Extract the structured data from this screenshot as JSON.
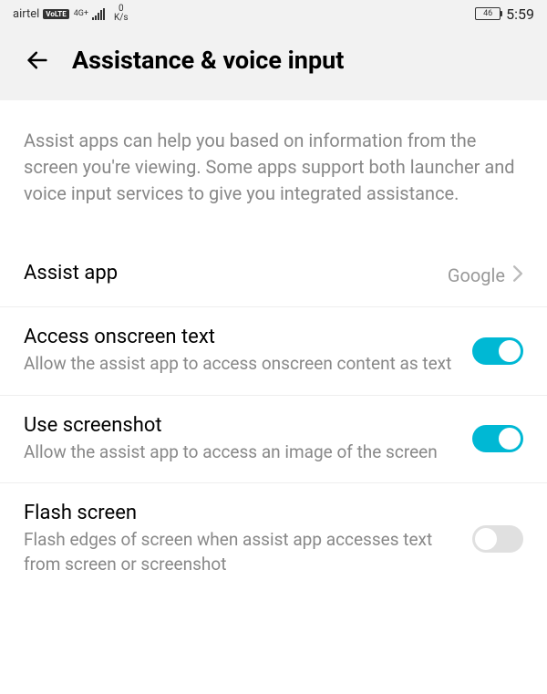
{
  "statusBar": {
    "carrier": "airtel",
    "volte": "VoLTE",
    "netType": "4G+",
    "speedVal": "0",
    "speedUnit": "K/s",
    "battery": "46",
    "time": "5:59"
  },
  "header": {
    "title": "Assistance & voice input"
  },
  "description": "Assist apps can help you based on information from the screen you're viewing. Some apps support both launcher and voice input services to give you integrated assistance.",
  "rows": {
    "assistApp": {
      "title": "Assist app",
      "value": "Google"
    },
    "accessText": {
      "title": "Access onscreen text",
      "subtitle": "Allow the assist app to access onscreen content as text"
    },
    "useScreenshot": {
      "title": "Use screenshot",
      "subtitle": "Allow the assist app to access an image of the screen"
    },
    "flashScreen": {
      "title": "Flash screen",
      "subtitle": "Flash edges of screen when assist app accesses text from screen or screenshot"
    }
  }
}
